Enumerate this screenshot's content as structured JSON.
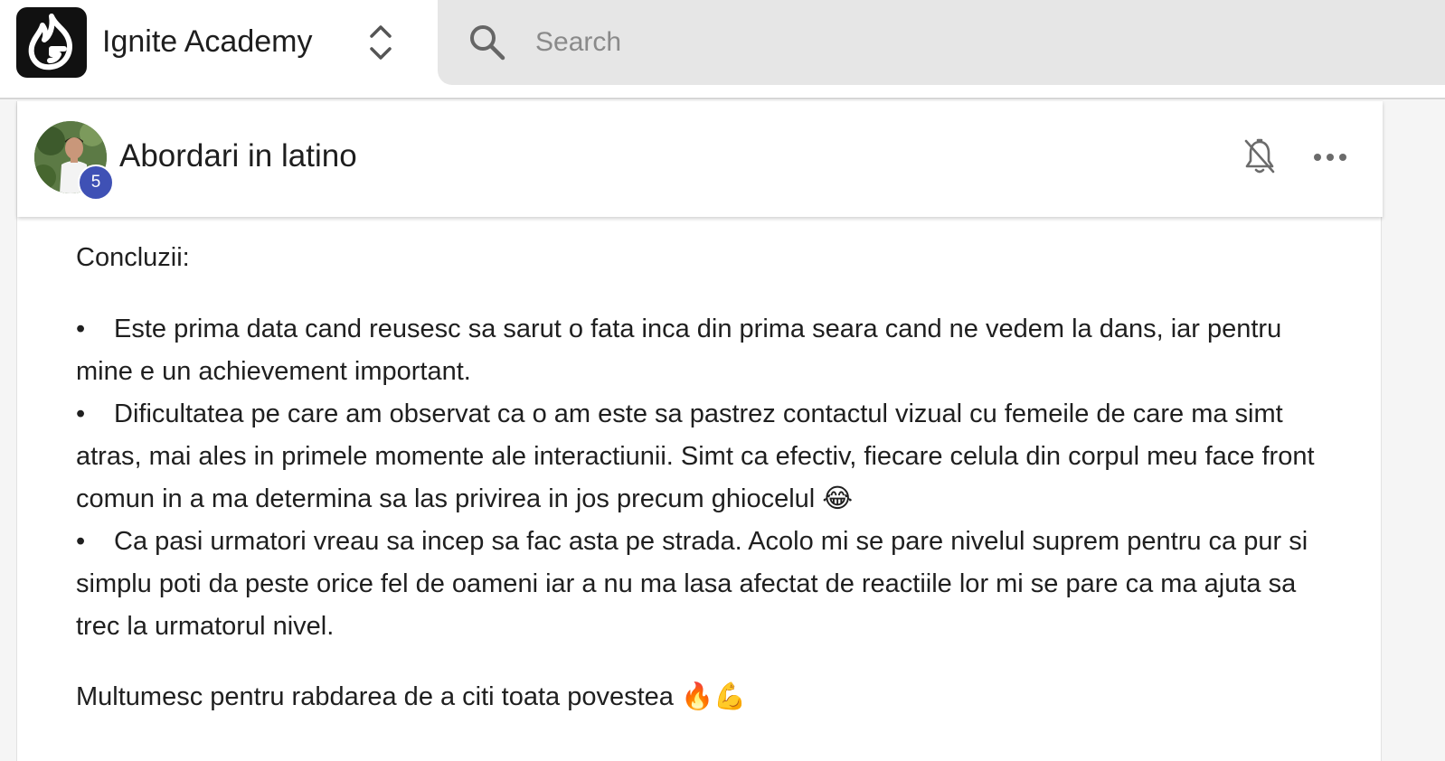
{
  "app": {
    "name": "Ignite Academy"
  },
  "search": {
    "placeholder": "Search"
  },
  "post": {
    "title": "Abordari in latino",
    "author_level": "5",
    "body": {
      "heading": "Concluzii:",
      "bullet_symbol": "•",
      "bullets": [
        "Este prima data cand reusesc sa sarut o fata inca din prima seara cand ne vedem la dans, iar pentru mine e un achievement important.",
        "Dificultatea pe care am observat ca o am este sa pastrez contactul vizual cu femeile de care ma simt atras, mai ales in primele momente ale interactiunii. Simt ca efectiv, fiecare celula din corpul meu face front comun in a ma determina sa las privirea in jos precum ghiocelul 😂",
        "Ca pasi urmatori vreau sa incep sa fac asta pe strada. Acolo mi se pare nivelul suprem pentru ca pur si simplu poti da peste orice fel de oameni iar a nu ma lasa afectat de reactiile lor mi se pare ca ma ajuta sa trec la urmatorul nivel."
      ],
      "closing": "Multumesc pentru rabdarea de a citi toata povestea 🔥💪"
    }
  },
  "icons": {
    "logo": "flame-g-logo-icon",
    "switcher": "chevron-up-down-icon",
    "search": "search-icon",
    "notifications": "bell-off-icon",
    "more": "more-horizontal-icon"
  },
  "colors": {
    "logo_bg": "#111111",
    "search_bg": "#e6e6e6",
    "level_badge": "#3f51b5",
    "page_bg": "#f5f5f5"
  }
}
